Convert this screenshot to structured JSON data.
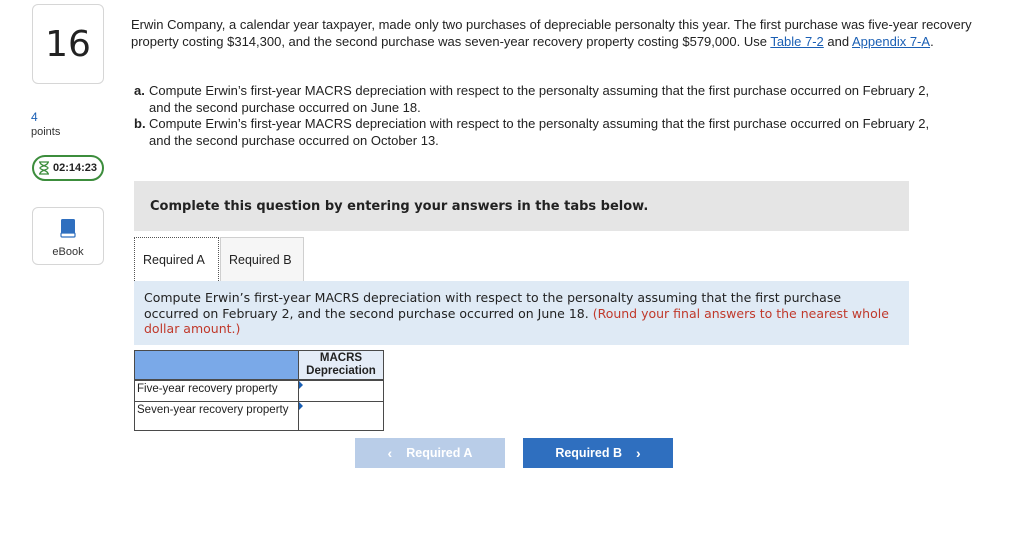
{
  "question": {
    "number": "16",
    "points_value": "4",
    "points_label": "points"
  },
  "timer": {
    "value": "02:14:23",
    "icon": "hourglass-icon"
  },
  "ebook": {
    "label": "eBook",
    "icon": "book-icon"
  },
  "problem": {
    "text_before": "Erwin Company, a calendar year taxpayer, made only two purchases of depreciable personalty this year. The first purchase was five-year recovery property costing $314,300, and the second purchase was seven-year recovery property costing $579,000. Use ",
    "link1": "Table 7-2",
    "text_mid": " and ",
    "link2": "Appendix 7-A",
    "text_end": "."
  },
  "parts": [
    {
      "letter": "a.",
      "text": "Compute Erwin’s first-year MACRS depreciation with respect to the personalty assuming that the first purchase occurred on February 2, and the second purchase occurred on June 18."
    },
    {
      "letter": "b.",
      "text": "Compute Erwin’s first-year MACRS depreciation with respect to the personalty assuming that the first purchase occurred on February 2, and the second purchase occurred on October 13."
    }
  ],
  "banner": "Complete this question by entering your answers in the tabs below.",
  "tabs": [
    {
      "label": "Required A",
      "active": true
    },
    {
      "label": "Required B",
      "active": false
    }
  ],
  "instruction": {
    "text": "Compute Erwin’s first-year MACRS depreciation with respect to the personalty assuming that the first purchase occurred on February 2, and the second purchase occurred on June 18. ",
    "note": "(Round your final answers to the nearest whole dollar amount.)"
  },
  "table": {
    "header": "MACRS Depreciation",
    "rows": [
      {
        "label": "Five-year recovery property",
        "value": ""
      },
      {
        "label": "Seven-year recovery property",
        "value": ""
      }
    ]
  },
  "nav": {
    "prev_label": "Required A",
    "next_label": "Required B"
  },
  "colors": {
    "accent": "#2f6fbf",
    "link": "#1a5fb4",
    "note": "#c0392b",
    "timer_border": "#3c8d3c",
    "header_blue": "#7aa9e8"
  }
}
